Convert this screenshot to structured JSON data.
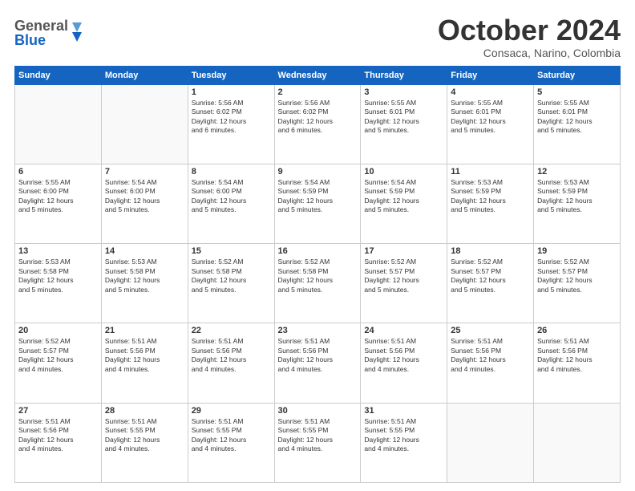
{
  "logo": {
    "line1": "General",
    "line2": "Blue"
  },
  "title": "October 2024",
  "subtitle": "Consaca, Narino, Colombia",
  "days": [
    "Sunday",
    "Monday",
    "Tuesday",
    "Wednesday",
    "Thursday",
    "Friday",
    "Saturday"
  ],
  "weeks": [
    [
      {
        "day": "",
        "content": ""
      },
      {
        "day": "",
        "content": ""
      },
      {
        "day": "1",
        "content": "Sunrise: 5:56 AM\nSunset: 6:02 PM\nDaylight: 12 hours\nand 6 minutes."
      },
      {
        "day": "2",
        "content": "Sunrise: 5:56 AM\nSunset: 6:02 PM\nDaylight: 12 hours\nand 6 minutes."
      },
      {
        "day": "3",
        "content": "Sunrise: 5:55 AM\nSunset: 6:01 PM\nDaylight: 12 hours\nand 5 minutes."
      },
      {
        "day": "4",
        "content": "Sunrise: 5:55 AM\nSunset: 6:01 PM\nDaylight: 12 hours\nand 5 minutes."
      },
      {
        "day": "5",
        "content": "Sunrise: 5:55 AM\nSunset: 6:01 PM\nDaylight: 12 hours\nand 5 minutes."
      }
    ],
    [
      {
        "day": "6",
        "content": "Sunrise: 5:55 AM\nSunset: 6:00 PM\nDaylight: 12 hours\nand 5 minutes."
      },
      {
        "day": "7",
        "content": "Sunrise: 5:54 AM\nSunset: 6:00 PM\nDaylight: 12 hours\nand 5 minutes."
      },
      {
        "day": "8",
        "content": "Sunrise: 5:54 AM\nSunset: 6:00 PM\nDaylight: 12 hours\nand 5 minutes."
      },
      {
        "day": "9",
        "content": "Sunrise: 5:54 AM\nSunset: 5:59 PM\nDaylight: 12 hours\nand 5 minutes."
      },
      {
        "day": "10",
        "content": "Sunrise: 5:54 AM\nSunset: 5:59 PM\nDaylight: 12 hours\nand 5 minutes."
      },
      {
        "day": "11",
        "content": "Sunrise: 5:53 AM\nSunset: 5:59 PM\nDaylight: 12 hours\nand 5 minutes."
      },
      {
        "day": "12",
        "content": "Sunrise: 5:53 AM\nSunset: 5:59 PM\nDaylight: 12 hours\nand 5 minutes."
      }
    ],
    [
      {
        "day": "13",
        "content": "Sunrise: 5:53 AM\nSunset: 5:58 PM\nDaylight: 12 hours\nand 5 minutes."
      },
      {
        "day": "14",
        "content": "Sunrise: 5:53 AM\nSunset: 5:58 PM\nDaylight: 12 hours\nand 5 minutes."
      },
      {
        "day": "15",
        "content": "Sunrise: 5:52 AM\nSunset: 5:58 PM\nDaylight: 12 hours\nand 5 minutes."
      },
      {
        "day": "16",
        "content": "Sunrise: 5:52 AM\nSunset: 5:58 PM\nDaylight: 12 hours\nand 5 minutes."
      },
      {
        "day": "17",
        "content": "Sunrise: 5:52 AM\nSunset: 5:57 PM\nDaylight: 12 hours\nand 5 minutes."
      },
      {
        "day": "18",
        "content": "Sunrise: 5:52 AM\nSunset: 5:57 PM\nDaylight: 12 hours\nand 5 minutes."
      },
      {
        "day": "19",
        "content": "Sunrise: 5:52 AM\nSunset: 5:57 PM\nDaylight: 12 hours\nand 5 minutes."
      }
    ],
    [
      {
        "day": "20",
        "content": "Sunrise: 5:52 AM\nSunset: 5:57 PM\nDaylight: 12 hours\nand 4 minutes."
      },
      {
        "day": "21",
        "content": "Sunrise: 5:51 AM\nSunset: 5:56 PM\nDaylight: 12 hours\nand 4 minutes."
      },
      {
        "day": "22",
        "content": "Sunrise: 5:51 AM\nSunset: 5:56 PM\nDaylight: 12 hours\nand 4 minutes."
      },
      {
        "day": "23",
        "content": "Sunrise: 5:51 AM\nSunset: 5:56 PM\nDaylight: 12 hours\nand 4 minutes."
      },
      {
        "day": "24",
        "content": "Sunrise: 5:51 AM\nSunset: 5:56 PM\nDaylight: 12 hours\nand 4 minutes."
      },
      {
        "day": "25",
        "content": "Sunrise: 5:51 AM\nSunset: 5:56 PM\nDaylight: 12 hours\nand 4 minutes."
      },
      {
        "day": "26",
        "content": "Sunrise: 5:51 AM\nSunset: 5:56 PM\nDaylight: 12 hours\nand 4 minutes."
      }
    ],
    [
      {
        "day": "27",
        "content": "Sunrise: 5:51 AM\nSunset: 5:56 PM\nDaylight: 12 hours\nand 4 minutes."
      },
      {
        "day": "28",
        "content": "Sunrise: 5:51 AM\nSunset: 5:55 PM\nDaylight: 12 hours\nand 4 minutes."
      },
      {
        "day": "29",
        "content": "Sunrise: 5:51 AM\nSunset: 5:55 PM\nDaylight: 12 hours\nand 4 minutes."
      },
      {
        "day": "30",
        "content": "Sunrise: 5:51 AM\nSunset: 5:55 PM\nDaylight: 12 hours\nand 4 minutes."
      },
      {
        "day": "31",
        "content": "Sunrise: 5:51 AM\nSunset: 5:55 PM\nDaylight: 12 hours\nand 4 minutes."
      },
      {
        "day": "",
        "content": ""
      },
      {
        "day": "",
        "content": ""
      }
    ]
  ]
}
